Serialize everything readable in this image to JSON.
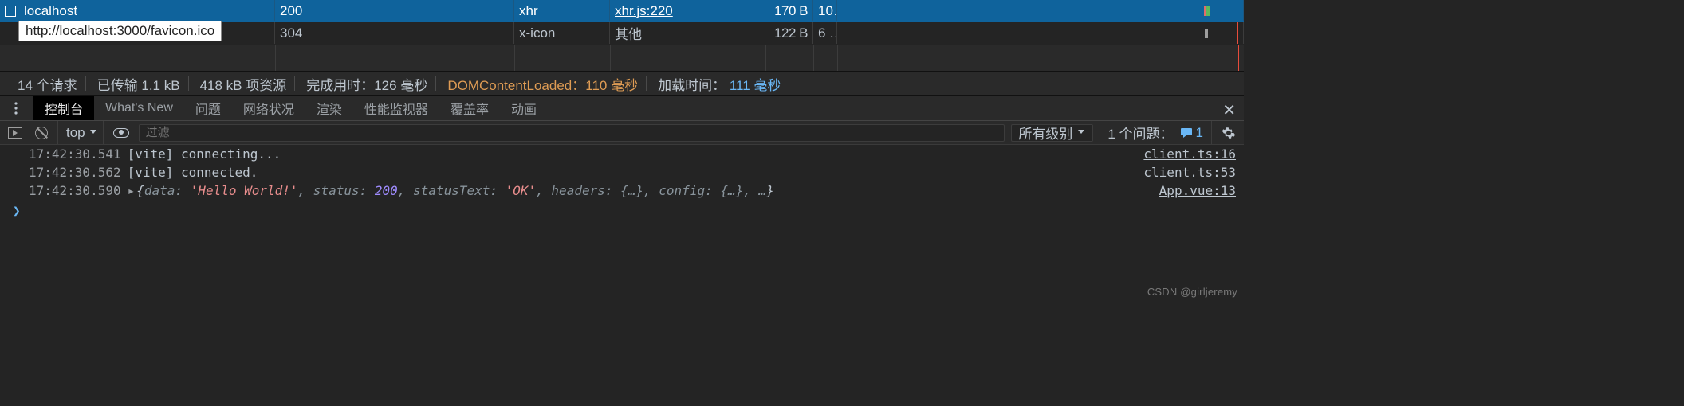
{
  "network": {
    "rows": [
      {
        "name": "localhost",
        "status": "200",
        "type": "xhr",
        "initiator": "xhr.js:220",
        "size": "170 B",
        "time": "10…"
      },
      {
        "name": "",
        "status": "304",
        "type": "x-icon",
        "initiator": "其他",
        "size": "122 B",
        "time": "6 …"
      }
    ],
    "tooltip": "http://localhost:3000/favicon.ico"
  },
  "status_bar": {
    "requests": "14 个请求",
    "transferred": "已传输 1.1 kB",
    "resources": "418 kB 项资源",
    "finish": "完成用时：126 毫秒",
    "dcl_label": "DOMContentLoaded：",
    "dcl_value": "110 毫秒",
    "load_label": "加载时间：",
    "load_value": "111 毫秒"
  },
  "drawer": {
    "tabs": [
      "控制台",
      "What's New",
      "问题",
      "网络状况",
      "渲染",
      "性能监视器",
      "覆盖率",
      "动画"
    ],
    "active_tab": "控制台",
    "close_glyph": "✕"
  },
  "console_toolbar": {
    "context": "top",
    "filter_placeholder": "过滤",
    "levels": "所有级别",
    "issues_label": "1 个问题：",
    "issues_count": "1"
  },
  "console_logs": [
    {
      "ts": "17:42:30.541",
      "msg_plain": "[vite] connecting...",
      "source": "client.ts:16"
    },
    {
      "ts": "17:42:30.562",
      "msg_plain": "[vite] connected.",
      "source": "client.ts:53"
    },
    {
      "ts": "17:42:30.590",
      "msg_object": {
        "data_str": "'Hello World!'",
        "status_num": "200",
        "statusText_str": "'OK'",
        "rest": ", headers: {…}, config: {…}, …"
      },
      "source": "App.vue:13"
    }
  ],
  "prompt": "❯",
  "watermark": "CSDN @girljeremy"
}
